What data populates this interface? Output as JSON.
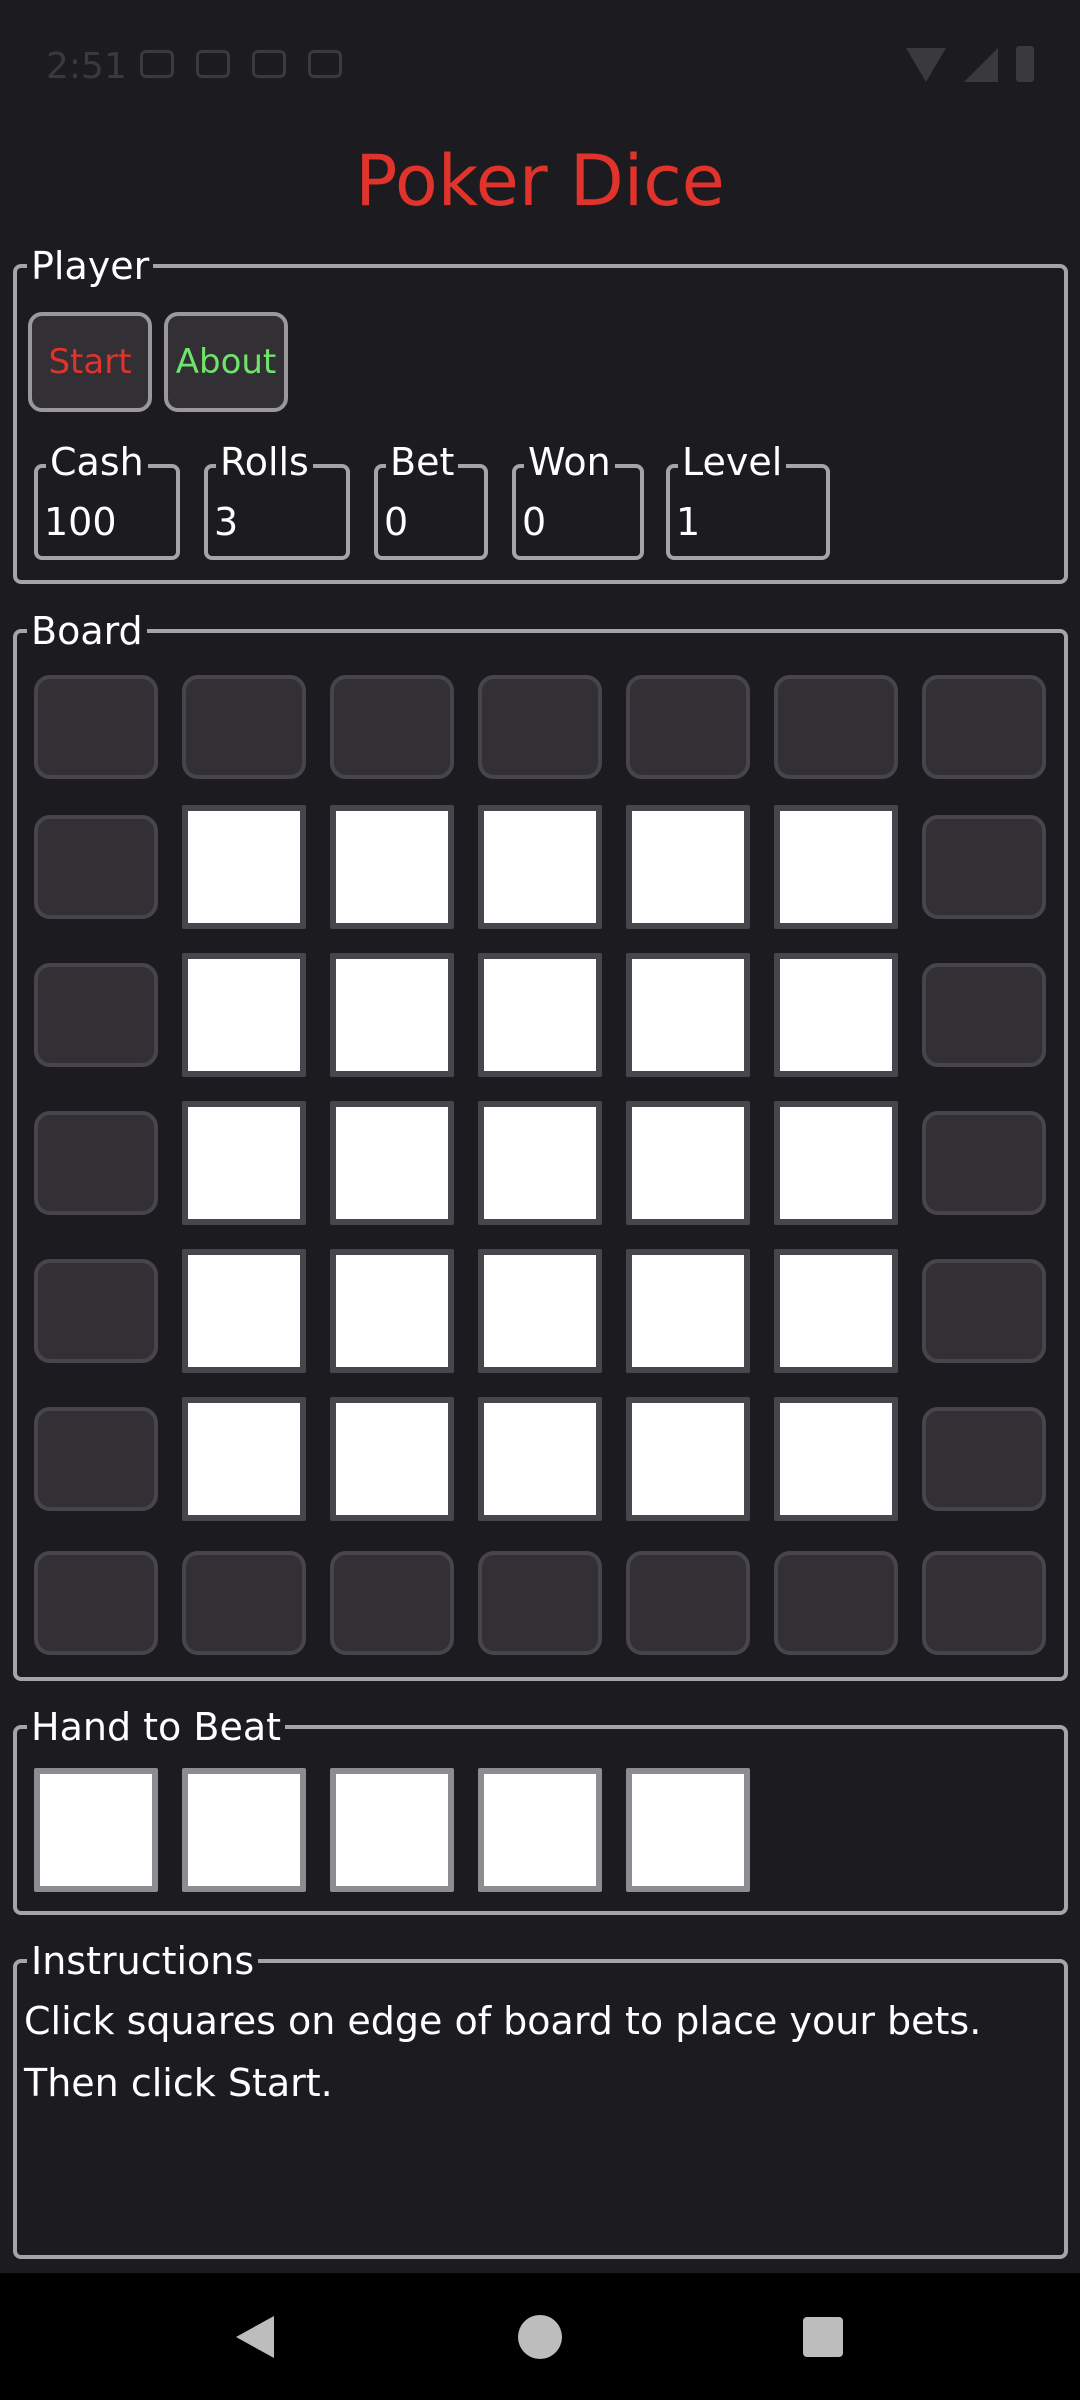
{
  "status_bar": {
    "time": "2:51"
  },
  "app": {
    "title": "Poker Dice"
  },
  "player": {
    "legend": "Player",
    "buttons": {
      "start": "Start",
      "about": "About"
    },
    "stats": [
      {
        "label": "Cash",
        "value": "100"
      },
      {
        "label": "Rolls",
        "value": "3"
      },
      {
        "label": "Bet",
        "value": "0"
      },
      {
        "label": "Won",
        "value": "0"
      },
      {
        "label": "Level",
        "value": "1"
      }
    ]
  },
  "board": {
    "legend": "Board",
    "rows": 7,
    "cols": 7
  },
  "hand": {
    "legend": "Hand to Beat",
    "dice_count": 5
  },
  "instructions": {
    "legend": "Instructions",
    "text": "Click squares on edge of board to place your bets. Then click Start."
  },
  "colors": {
    "title": "#e0332b",
    "start": "#e0332b",
    "about": "#6fe36a",
    "background": "#1c1b1f",
    "cell": "#322f35",
    "die": "#ffffff"
  }
}
